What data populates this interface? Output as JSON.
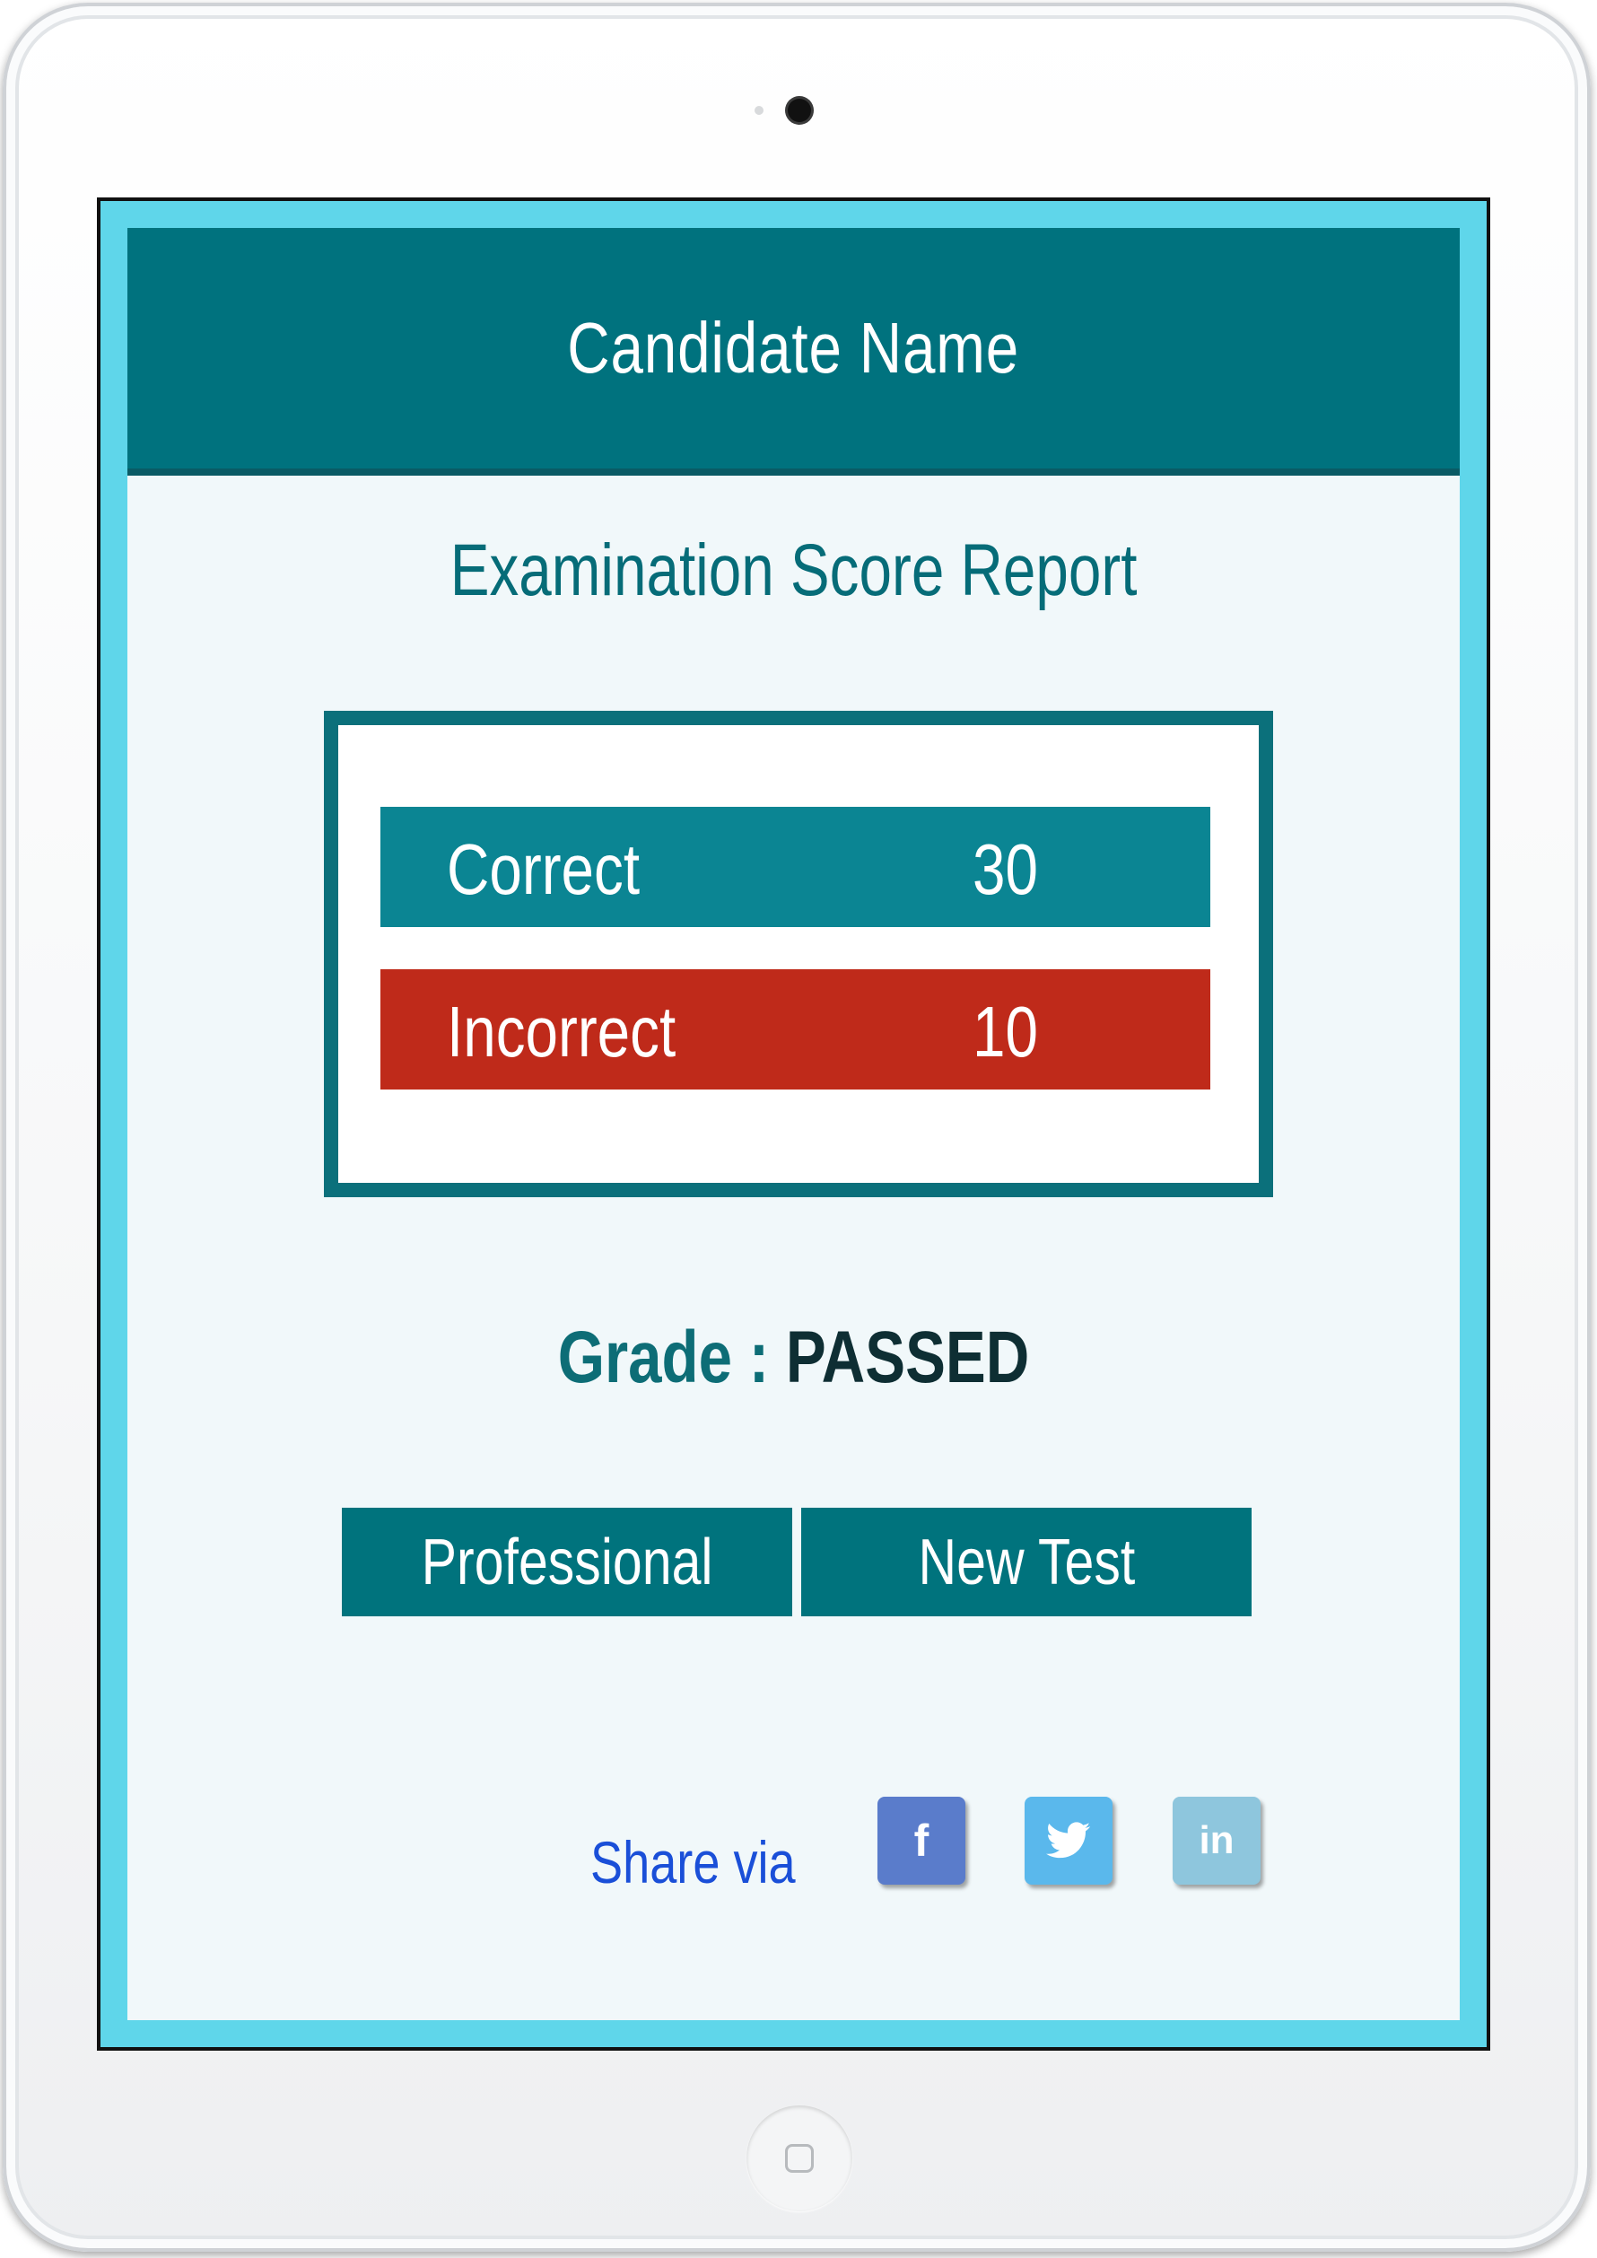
{
  "header": {
    "title": "Candidate Name"
  },
  "report": {
    "title": "Examination Score Report"
  },
  "scores": {
    "correct": {
      "label": "Correct",
      "value": "30",
      "color": "#0b8593"
    },
    "incorrect": {
      "label": "Incorrect",
      "value": "10",
      "color": "#bf2a1a"
    }
  },
  "grade": {
    "label": "Grade",
    "separator": ":",
    "value": "PASSED"
  },
  "buttons": {
    "professional": "Professional",
    "new_test": "New Test"
  },
  "share": {
    "label": "Share via",
    "facebook": "f",
    "linkedin": "in",
    "icons": [
      "facebook-icon",
      "twitter-icon",
      "linkedin-icon"
    ]
  },
  "colors": {
    "accent": "#00727e",
    "screen_border": "#5fd6ea",
    "facebook": "#5a7ccb",
    "twitter": "#5ab8ec",
    "linkedin": "#8ec6dd"
  }
}
